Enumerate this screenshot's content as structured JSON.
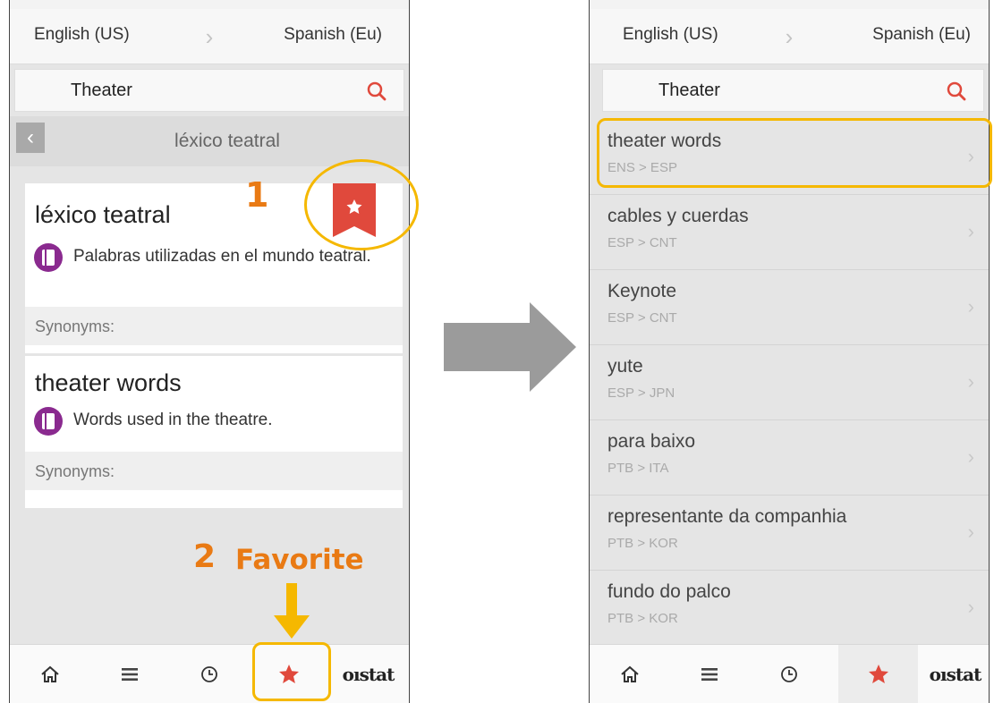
{
  "left_screen": {
    "lang_from": "English (US)",
    "lang_to": "Spanish (Eu)",
    "search_query": "Theater",
    "nav_title": "léxico teatral",
    "entries": [
      {
        "term": "léxico teatral",
        "definition": "Palabras utilizadas en el mundo teatral.",
        "synonyms_label": "Synonyms:"
      },
      {
        "term": "theater words",
        "definition": "Words used in the theatre.",
        "synonyms_label": "Synonyms:"
      }
    ],
    "annotations": {
      "step1": "1",
      "step2": "2",
      "step2_label": "Favorite"
    }
  },
  "right_screen": {
    "lang_from": "English (US)",
    "lang_to": "Spanish (Eu)",
    "search_query": "Theater",
    "favorites": [
      {
        "title": "theater words",
        "langs": "ENS > ESP"
      },
      {
        "title": "cables y cuerdas",
        "langs": "ESP > CNT"
      },
      {
        "title": "Keynote",
        "langs": "ESP > CNT"
      },
      {
        "title": "yute",
        "langs": "ESP > JPN"
      },
      {
        "title": "para baixo",
        "langs": "PTB > ITA"
      },
      {
        "title": "representante da companhia",
        "langs": "PTB > KOR"
      },
      {
        "title": "fundo do palco",
        "langs": "PTB > KOR"
      }
    ]
  },
  "tabbar": {
    "tabs": [
      "home-icon",
      "menu-icon",
      "clock-icon",
      "star-icon"
    ],
    "logo": "oıstat"
  },
  "colors": {
    "accent_red": "#e0493c",
    "highlight_yellow": "#f5b800",
    "annotation_orange": "#e97a14",
    "definition_purple": "#8a2a8f"
  }
}
